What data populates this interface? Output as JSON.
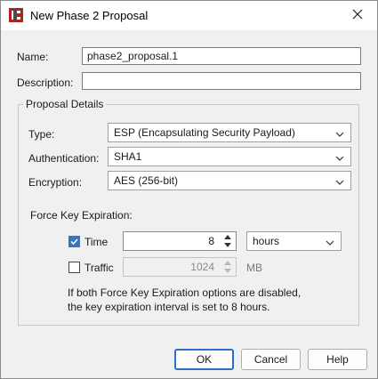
{
  "window": {
    "title": "New Phase 2 Proposal",
    "app_icon": "watchguard-logo-icon",
    "close_icon": "close-icon"
  },
  "form": {
    "name_label": "Name:",
    "name_value": "phase2_proposal.1",
    "description_label": "Description:",
    "description_value": ""
  },
  "proposal_details": {
    "title": "Proposal Details",
    "type_label": "Type:",
    "type_value": "ESP (Encapsulating Security Payload)",
    "authentication_label": "Authentication:",
    "authentication_value": "SHA1",
    "encryption_label": "Encryption:",
    "encryption_value": "AES (256-bit)",
    "force_key_label": "Force Key Expiration:",
    "time": {
      "label": "Time",
      "checked": true,
      "value": "8",
      "unit": "hours"
    },
    "traffic": {
      "label": "Traffic",
      "checked": false,
      "value": "1024",
      "unit": "MB"
    },
    "note_line1": "If both Force Key Expiration options are disabled,",
    "note_line2": "the key expiration interval is set to 8 hours."
  },
  "buttons": {
    "ok": "OK",
    "cancel": "Cancel",
    "help": "Help"
  },
  "colors": {
    "accent": "#2d6fd0",
    "checkbox": "#3574c7",
    "logo_red": "#b0221c"
  }
}
